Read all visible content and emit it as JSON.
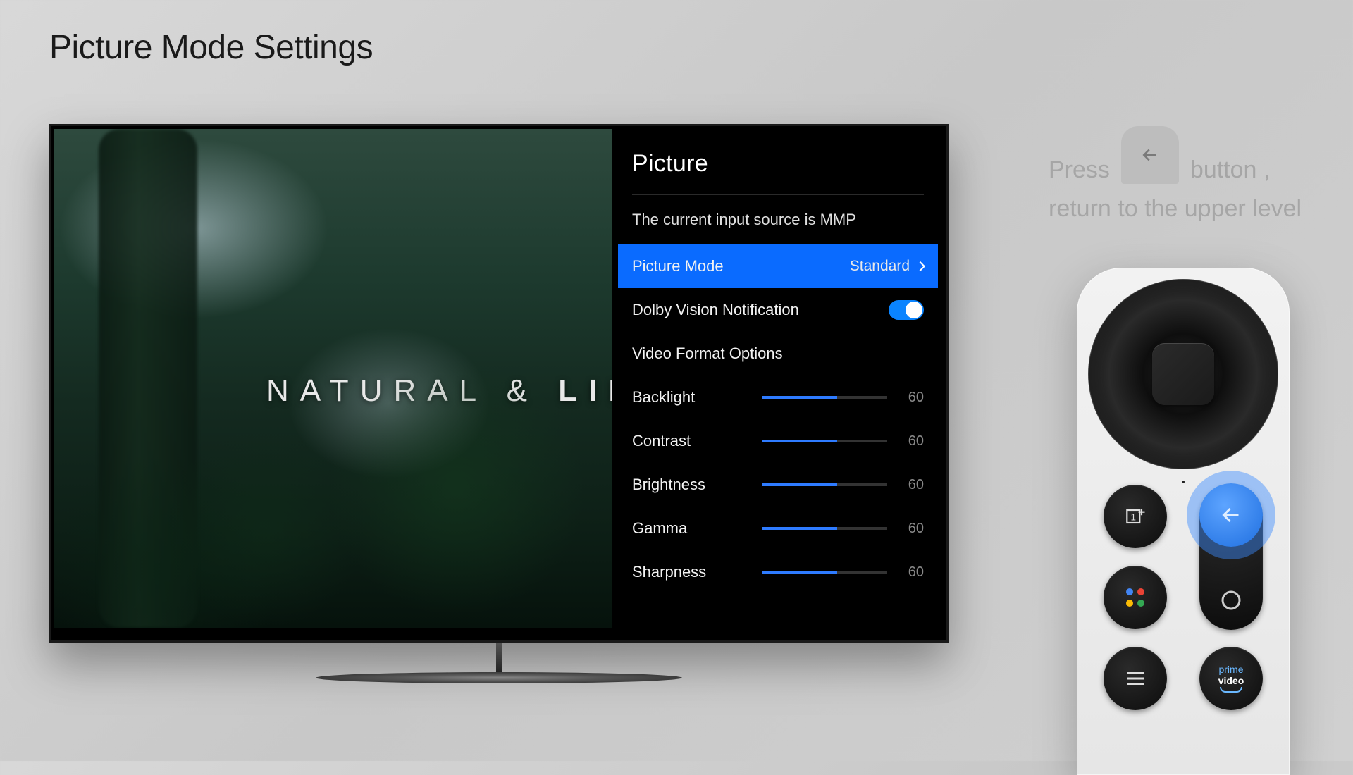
{
  "page_title": "Picture Mode Settings",
  "hero_text_a": "NATURAL & ",
  "hero_text_b": "LIFE",
  "panel": {
    "title": "Picture",
    "subtext": "The current input source is MMP",
    "picture_mode": {
      "label": "Picture Mode",
      "value": "Standard"
    },
    "dolby": {
      "label": "Dolby Vision Notification",
      "on": true
    },
    "video_format": {
      "label": "Video Format Options"
    },
    "sliders": [
      {
        "label": "Backlight",
        "value": 60,
        "max": 100
      },
      {
        "label": "Contrast",
        "value": 60,
        "max": 100
      },
      {
        "label": "Brightness",
        "value": 60,
        "max": 100
      },
      {
        "label": "Gamma",
        "value": 60,
        "max": 100
      },
      {
        "label": "Sharpness",
        "value": 60,
        "max": 100
      }
    ]
  },
  "instruction": {
    "press": "Press",
    "button_comma": "button ,",
    "line2": "return to the upper level"
  }
}
